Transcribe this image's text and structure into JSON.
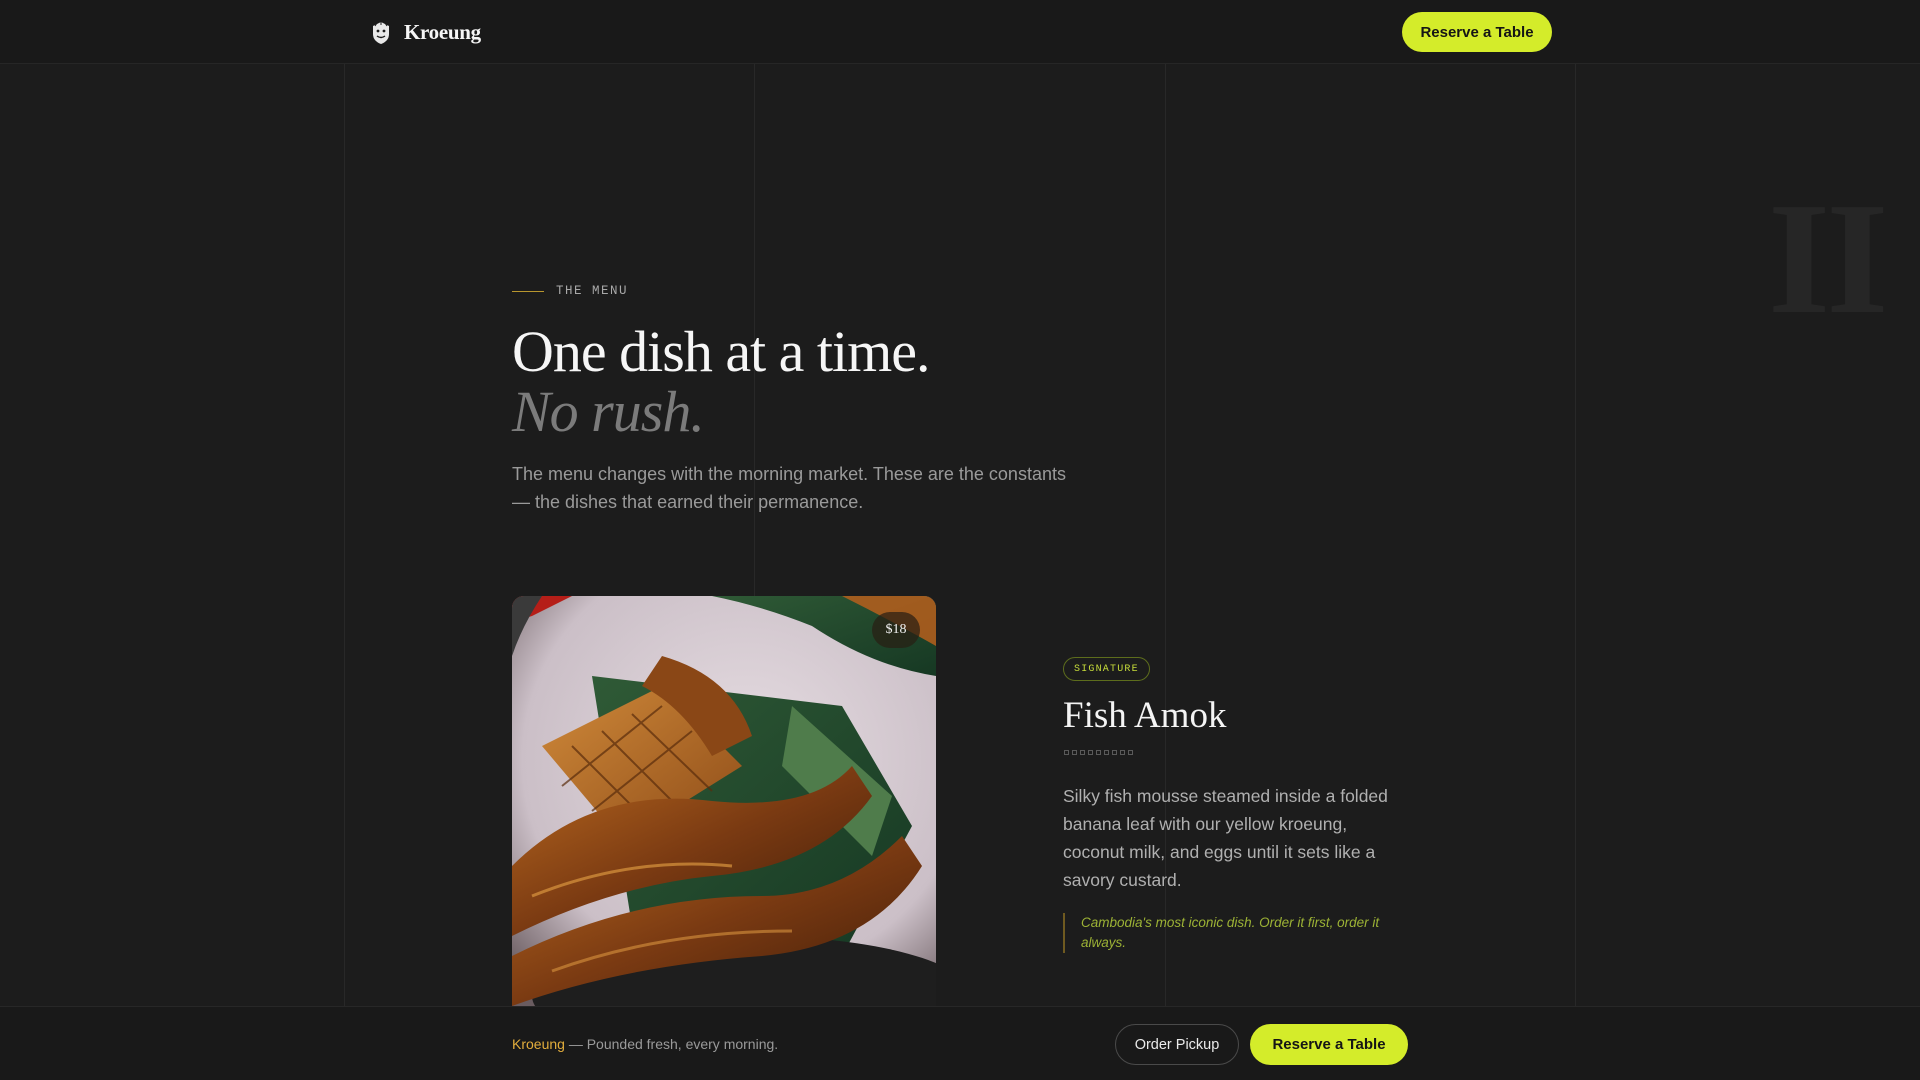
{
  "brand": {
    "name": "Kroeung",
    "icon": "lion-crest-icon"
  },
  "nav": {
    "reserve_label": "Reserve a Table"
  },
  "section_numeral": "II",
  "menu_section": {
    "eyebrow": "THE MENU",
    "headline_line1": "One dish at a time.",
    "headline_line2": "No rush.",
    "intro": "The menu changes with the morning market. These are the constants — the dishes that earned their permanence."
  },
  "featured_dish": {
    "price": "$18",
    "tag": "SIGNATURE",
    "name": "Fish Amok",
    "description": "Silky fish mousse steamed inside a folded banana leaf with our yellow kroeung, coconut milk, and eggs until it sets like a savory custard.",
    "note": "Cambodia's most iconic dish. Order it first, order it always."
  },
  "bottom_bar": {
    "brand": "Kroeung",
    "tagline": " — Pounded fresh, every morning.",
    "order_label": "Order Pickup",
    "reserve_label": "Reserve a Table"
  },
  "colors": {
    "background": "#1c1c1c",
    "accent_lime": "#d4ec2a",
    "accent_gold": "#e2ad3c"
  }
}
